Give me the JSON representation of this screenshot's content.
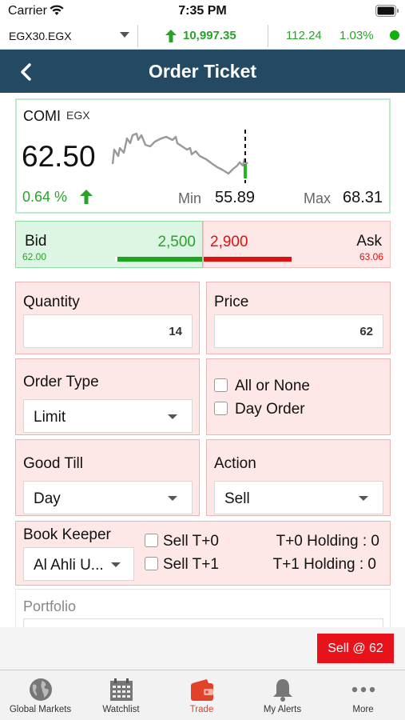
{
  "status_bar": {
    "carrier": "Carrier",
    "time": "7:35 PM"
  },
  "ticker": {
    "symbol": "EGX30.EGX",
    "index_value": "10,997.35",
    "change": "112.24",
    "change_pct": "1.03%"
  },
  "header": {
    "title": "Order Ticket"
  },
  "quote": {
    "symbol": "COMI",
    "exchange": "EGX",
    "price": "62.50",
    "change_pct": "0.64 %",
    "min_label": "Min",
    "min_value": "55.89",
    "max_label": "Max",
    "max_value": "68.31"
  },
  "bid_ask": {
    "bid_label": "Bid",
    "bid_price": "62.00",
    "bid_qty": "2,500",
    "bid_fill": 0.96,
    "ask_label": "Ask",
    "ask_price": "63.06",
    "ask_qty": "2,900",
    "ask_fill": 1.0
  },
  "form": {
    "quantity_label": "Quantity",
    "quantity_value": "14",
    "price_label": "Price",
    "price_value": "62",
    "order_type_label": "Order Type",
    "order_type_value": "Limit",
    "all_or_none_label": "All or None",
    "day_order_label": "Day Order",
    "good_till_label": "Good Till",
    "good_till_value": "Day",
    "action_label": "Action",
    "action_value": "Sell",
    "book_keeper_label": "Book Keeper",
    "book_keeper_value": "Al Ahli U...",
    "sell_t0_label": "Sell T+0",
    "sell_t1_label": "Sell T+1",
    "t0_holding": "T+0 Holding : 0",
    "t1_holding": "T+1 Holding : 0",
    "portfolio_label": "Portfolio"
  },
  "submit": {
    "label": "Sell @ 62"
  },
  "tabs": [
    {
      "label": "Global Markets",
      "icon": "globe-icon"
    },
    {
      "label": "Watchlist",
      "icon": "calendar-grid-icon"
    },
    {
      "label": "Trade",
      "icon": "wallet-icon"
    },
    {
      "label": "My Alerts",
      "icon": "bell-icon"
    },
    {
      "label": "More",
      "icon": "more-dots-icon"
    }
  ],
  "colors": {
    "navbar": "#244a63",
    "positive": "#2aa12a",
    "negative": "#e01010",
    "sell_button": "#e8131a",
    "active_tab": "#e2412a"
  }
}
